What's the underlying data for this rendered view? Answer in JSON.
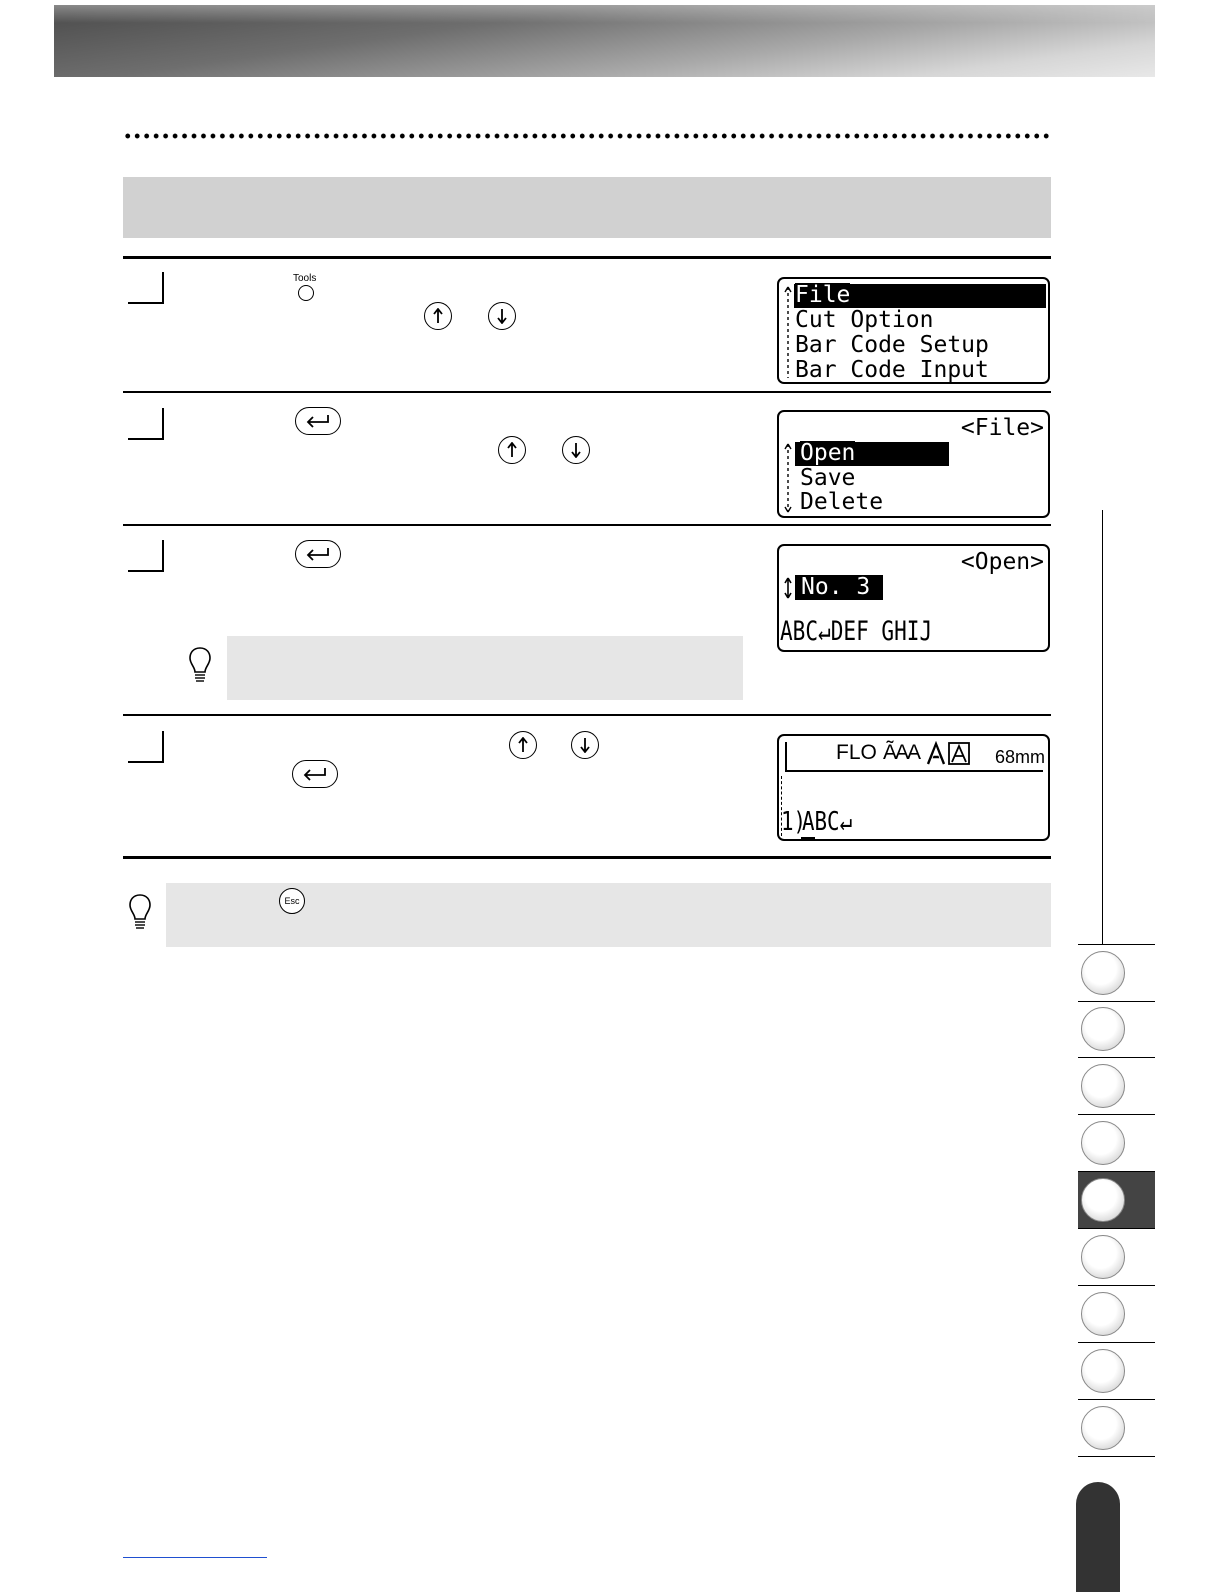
{
  "header": {
    "accent_color": "#5a5a5a"
  },
  "step1": {
    "tools_key_label": "Tools",
    "icons": [
      "tools-key-icon",
      "up-arrow-key-icon",
      "down-arrow-key-icon"
    ],
    "lcd_lines": [
      "File",
      "Cut Option",
      "Bar Code Setup",
      "Bar Code Input"
    ]
  },
  "step2": {
    "icons": [
      "enter-key-icon",
      "up-arrow-key-icon",
      "down-arrow-key-icon"
    ],
    "lcd_title": "<File>",
    "lcd_lines": [
      "Open",
      "Save",
      "Delete"
    ]
  },
  "step3": {
    "icons": [
      "enter-key-icon"
    ],
    "lcd_title": "<Open>",
    "lcd_number": "No. 3",
    "lcd_text": "ABC↵DEF GHIJ"
  },
  "step4": {
    "icons": [
      "up-arrow-key-icon",
      "down-arrow-key-icon",
      "enter-key-icon"
    ],
    "lcd_status": {
      "mode": "FLO",
      "size_icon": "ÃAA",
      "length": "68mm"
    },
    "lcd_text_prefix": "1)",
    "lcd_text": "ABC↵"
  },
  "note": {
    "esc_key_label": "Esc"
  },
  "sidebar": {
    "tab_count": 9,
    "active_tab_index": 5
  }
}
